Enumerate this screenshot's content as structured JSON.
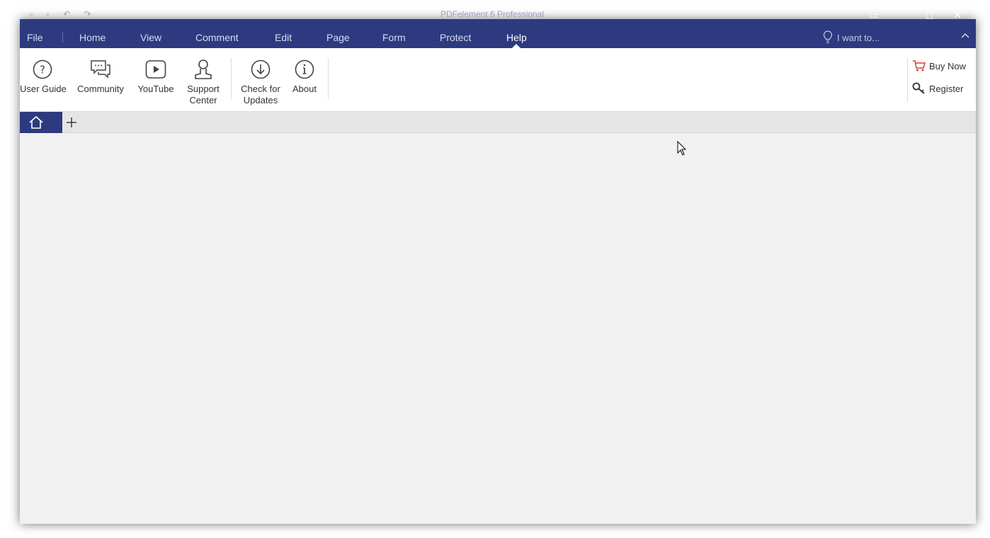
{
  "window": {
    "title": "PDFelement 6 Professional",
    "accent_color": "#2e3a80"
  },
  "menu": {
    "items": [
      {
        "label": "File",
        "name": "menu-file"
      },
      {
        "label": "Home",
        "name": "menu-home"
      },
      {
        "label": "View",
        "name": "menu-view"
      },
      {
        "label": "Comment",
        "name": "menu-comment"
      },
      {
        "label": "Edit",
        "name": "menu-edit"
      },
      {
        "label": "Page",
        "name": "menu-page"
      },
      {
        "label": "Form",
        "name": "menu-form"
      },
      {
        "label": "Protect",
        "name": "menu-protect"
      },
      {
        "label": "Help",
        "name": "menu-help",
        "active": true
      }
    ],
    "search_placeholder": "I want to...",
    "search_icon": "lightbulb-icon",
    "collapse_icon": "chevron-up-icon"
  },
  "ribbon": {
    "buttons": [
      {
        "label": "User Guide",
        "icon": "question-circle-icon"
      },
      {
        "label": "Community",
        "icon": "chat-bubbles-icon"
      },
      {
        "label": "YouTube",
        "icon": "play-button-icon"
      },
      {
        "label": "Support Center",
        "icon": "person-icon"
      },
      {
        "label": "Check for Updates",
        "icon": "download-circle-icon"
      },
      {
        "label": "About",
        "icon": "info-circle-icon"
      }
    ],
    "side": {
      "buy_now": {
        "label": "Buy Now",
        "icon": "cart-icon",
        "icon_color": "#e03a3a"
      },
      "register": {
        "label": "Register",
        "icon": "key-icon"
      }
    }
  },
  "tabs": {
    "home_icon": "home-icon",
    "new_tab_icon": "plus-icon"
  }
}
